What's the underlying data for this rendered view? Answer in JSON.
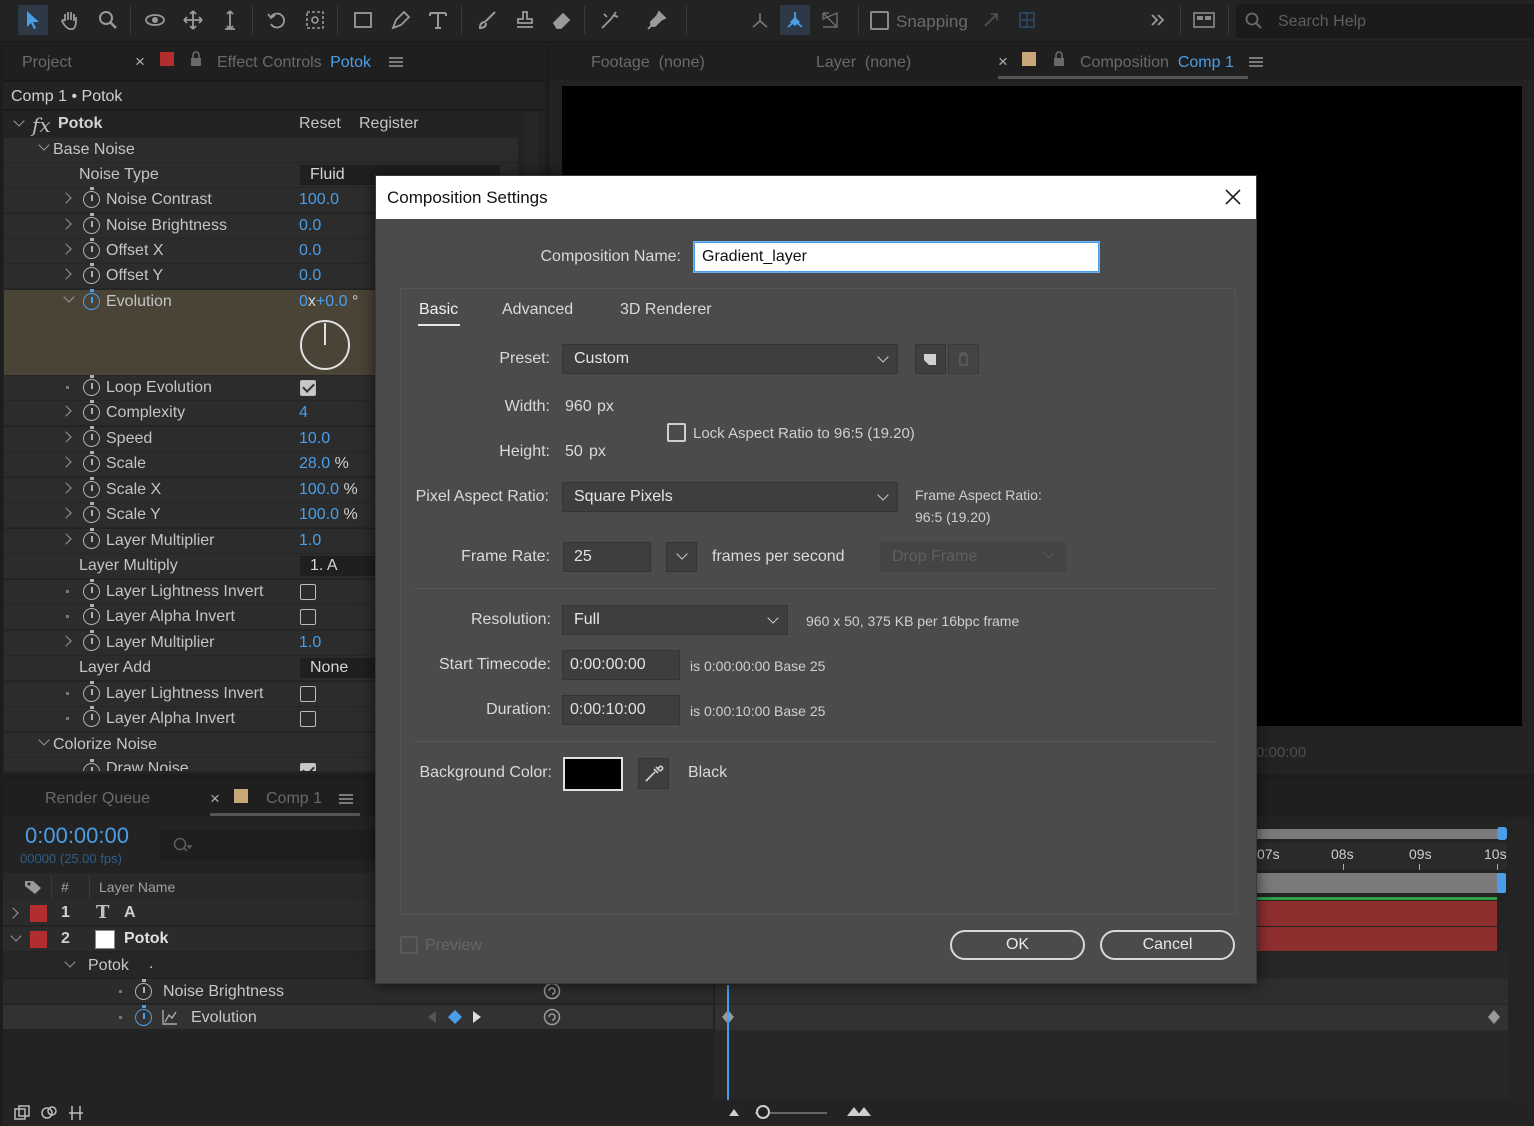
{
  "toolbar": {
    "snapping_label": "Snapping",
    "search_placeholder": "Search Help"
  },
  "project_panel": {
    "project_tab": "Project",
    "effect_controls_tab": "Effect Controls",
    "effect_controls_layer": "Potok",
    "breadcrumb": "Comp 1 • Potok"
  },
  "effect": {
    "name": "Potok",
    "reset_label": "Reset",
    "register_label": "Register",
    "base_noise_group": "Base Noise",
    "rows": [
      {
        "label": "Noise Type",
        "value": "Fluid"
      },
      {
        "label": "Noise Contrast",
        "value": "100.0"
      },
      {
        "label": "Noise Brightness",
        "value": "0.0"
      },
      {
        "label": "Offset X",
        "value": "0.0"
      },
      {
        "label": "Offset Y",
        "value": "0.0"
      },
      {
        "label": "Evolution",
        "value": "0",
        "value_suffix": "x",
        "value2": "+0.0",
        "value2_suffix": "°"
      },
      {
        "label": "Loop Evolution",
        "checked": true
      },
      {
        "label": "Complexity",
        "value": "4"
      },
      {
        "label": "Speed",
        "value": "10.0"
      },
      {
        "label": "Scale",
        "value": "28.0",
        "unit": "%"
      },
      {
        "label": "Scale X",
        "value": "100.0",
        "unit": "%"
      },
      {
        "label": "Scale Y",
        "value": "100.0",
        "unit": "%"
      },
      {
        "label": "Layer Multiplier",
        "value": "1.0"
      },
      {
        "label": "Layer Multiply",
        "value": "1. A"
      },
      {
        "label": "Layer Lightness Invert",
        "checked": false
      },
      {
        "label": "Layer Alpha Invert",
        "checked": false
      },
      {
        "label": "Layer Multiplier",
        "value": "1.0"
      },
      {
        "label": "Layer Add",
        "value": "None"
      },
      {
        "label": "Layer Lightness Invert",
        "checked": false
      },
      {
        "label": "Layer Alpha Invert",
        "checked": false
      }
    ],
    "colorize_group": "Colorize Noise",
    "draw_noise_row": "Draw Noise"
  },
  "viewer": {
    "footage_tab": "Footage",
    "footage_value": "(none)",
    "layer_tab": "Layer",
    "layer_value": "(none)",
    "composition_tab": "Composition",
    "composition_name": "Comp 1",
    "timecode_partial": "0:00:00"
  },
  "timeline": {
    "render_queue_tab": "Render Queue",
    "comp_tab": "Comp 1",
    "current_time": "0:00:00:00",
    "frame_info": "00000 (25.00 fps)",
    "col_number": "#",
    "col_layer_name": "Layer Name",
    "layers": [
      {
        "number": "1",
        "name": "A",
        "type": "text"
      },
      {
        "number": "2",
        "name": "Potok",
        "type": "solid"
      }
    ],
    "sub_effect": "Potok",
    "sub_effect_dot": ".",
    "properties": [
      "Noise Brightness",
      "Evolution"
    ],
    "ruler": [
      "07s",
      "08s",
      "09s",
      "10s"
    ]
  },
  "dialog": {
    "title": "Composition Settings",
    "comp_name_label": "Composition Name:",
    "comp_name_value": "Gradient_layer",
    "tabs": [
      "Basic",
      "Advanced",
      "3D Renderer"
    ],
    "preset_label": "Preset:",
    "preset_value": "Custom",
    "width_label": "Width:",
    "width_value": "960",
    "height_label": "Height:",
    "height_value": "50",
    "px_unit": "px",
    "lock_aspect_label": "Lock Aspect Ratio to 96:5 (19.20)",
    "par_label": "Pixel Aspect Ratio:",
    "par_value": "Square Pixels",
    "frame_aspect_label": "Frame Aspect Ratio:",
    "frame_aspect_value": "96:5 (19.20)",
    "frame_rate_label": "Frame Rate:",
    "frame_rate_value": "25",
    "fps_label": "frames per second",
    "drop_frame_label": "Drop Frame",
    "resolution_label": "Resolution:",
    "resolution_value": "Full",
    "resolution_info": "960 x 50, 375 KB per 16bpc frame",
    "start_tc_label": "Start Timecode:",
    "start_tc_value": "0:00:00:00",
    "start_tc_info": "is 0:00:00:00  Base 25",
    "duration_label": "Duration:",
    "duration_value": "0:00:10:00",
    "duration_info": "is 0:00:10:00  Base 25",
    "bg_color_label": "Background Color:",
    "bg_color_name": "Black",
    "bg_color_hex": "#000000",
    "preview_label": "Preview",
    "ok_label": "OK",
    "cancel_label": "Cancel"
  },
  "colors": {
    "accent_blue": "#4a9ee8",
    "label_red": "#b22d2d",
    "comp_tan": "#c8a878",
    "layer_bar_red": "#8e2f2f",
    "keyframe_green": "#2ea043"
  }
}
